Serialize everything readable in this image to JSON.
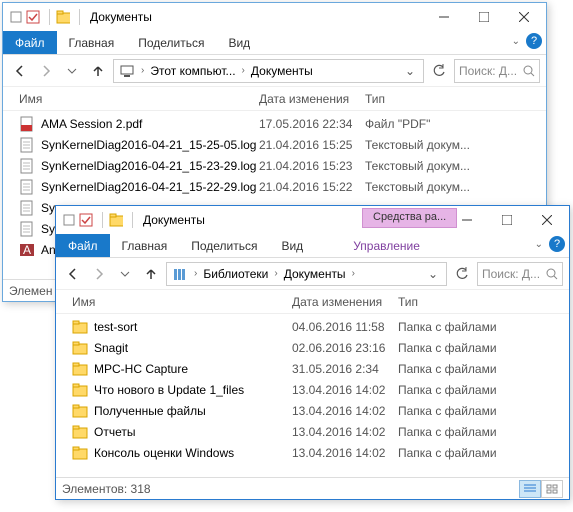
{
  "w1": {
    "title": "Документы",
    "tabs": {
      "file": "Файл",
      "home": "Главная",
      "share": "Поделиться",
      "view": "Вид"
    },
    "crumbs": {
      "c1": "Этот компьют...",
      "c2": "Документы"
    },
    "search_ph": "Поиск: Д...",
    "cols": {
      "name": "Имя",
      "date": "Дата изменения",
      "type": "Тип"
    },
    "files": {
      "f0": {
        "name": "AMA Session 2.pdf",
        "date": "17.05.2016 22:34",
        "type": "Файл \"PDF\""
      },
      "f1": {
        "name": "SynKernelDiag2016-04-21_15-25-05.log",
        "date": "21.04.2016 15:25",
        "type": "Текстовый докум..."
      },
      "f2": {
        "name": "SynKernelDiag2016-04-21_15-23-29.log",
        "date": "21.04.2016 15:23",
        "type": "Текстовый докум..."
      },
      "f3": {
        "name": "SynKernelDiag2016-04-21_15-22-29.log",
        "date": "21.04.2016 15:22",
        "type": "Текстовый докум..."
      },
      "f4": {
        "name": "Sy"
      },
      "f5": {
        "name": "Sy"
      },
      "f6": {
        "name": "An"
      }
    },
    "status": "Элемен"
  },
  "w2": {
    "title": "Документы",
    "context_tab": "Средства ра...",
    "tabs": {
      "file": "Файл",
      "home": "Главная",
      "share": "Поделиться",
      "view": "Вид",
      "mgmt": "Управление"
    },
    "crumbs": {
      "c1": "Библиотеки",
      "c2": "Документы"
    },
    "search_ph": "Поиск: Д...",
    "cols": {
      "name": "Имя",
      "date": "Дата изменения",
      "type": "Тип"
    },
    "files": {
      "f0": {
        "name": "test-sort",
        "date": "04.06.2016 11:58",
        "type": "Папка с файлами"
      },
      "f1": {
        "name": "Snagit",
        "date": "02.06.2016 23:16",
        "type": "Папка с файлами"
      },
      "f2": {
        "name": "MPC-HC Capture",
        "date": "31.05.2016 2:34",
        "type": "Папка с файлами"
      },
      "f3": {
        "name": "Что нового в Update 1_files",
        "date": "13.04.2016 14:02",
        "type": "Папка с файлами"
      },
      "f4": {
        "name": "Полученные файлы",
        "date": "13.04.2016 14:02",
        "type": "Папка с файлами"
      },
      "f5": {
        "name": "Отчеты",
        "date": "13.04.2016 14:02",
        "type": "Папка с файлами"
      },
      "f6": {
        "name": "Консоль оценки Windows",
        "date": "13.04.2016 14:02",
        "type": "Папка с файлами"
      }
    },
    "status": "Элементов: 318"
  }
}
